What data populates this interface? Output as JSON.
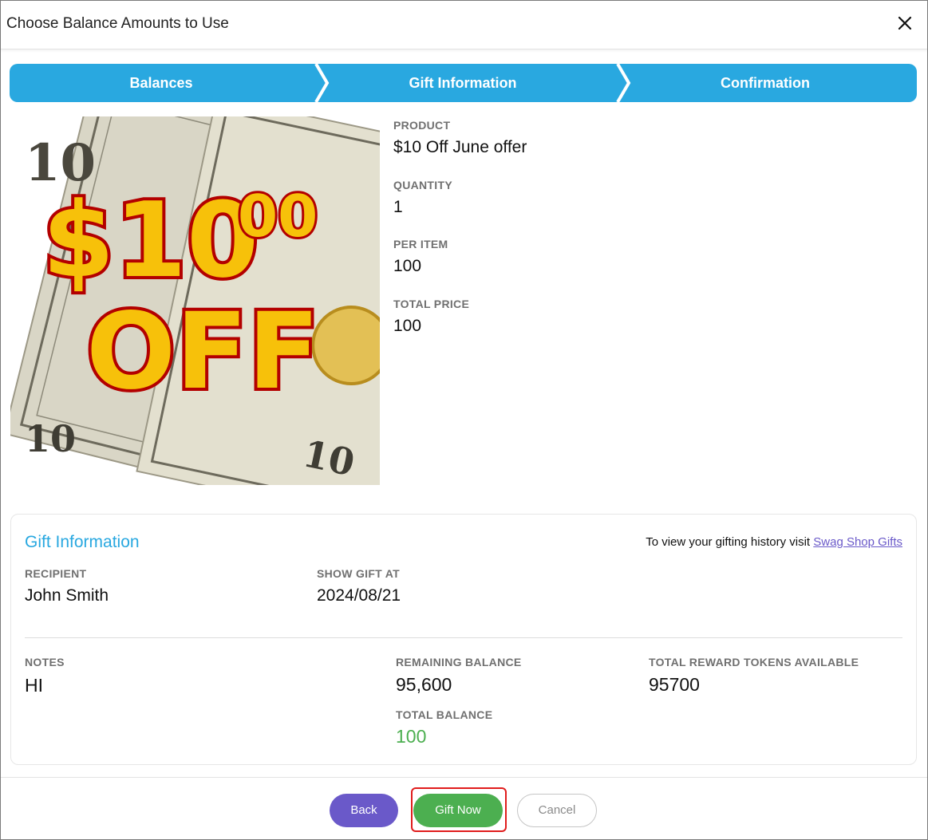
{
  "dialog": {
    "title": "Choose Balance Amounts to Use"
  },
  "stepper": {
    "steps": [
      {
        "label": "Balances"
      },
      {
        "label": "Gift Information"
      },
      {
        "label": "Confirmation"
      }
    ],
    "color": "#29a8e0"
  },
  "product_image": {
    "text_main": "$10",
    "text_cents": "00",
    "text_off": "OFF",
    "bill_number": "10"
  },
  "product": {
    "product_label": "PRODUCT",
    "product_value": "$10 Off June offer",
    "quantity_label": "QUANTITY",
    "quantity_value": "1",
    "per_item_label": "PER ITEM",
    "per_item_value": "100",
    "total_price_label": "TOTAL PRICE",
    "total_price_value": "100"
  },
  "gift_info": {
    "title": "Gift Information",
    "history_text": "To view your gifting history visit ",
    "history_link": "Swag Shop Gifts",
    "recipient_label": "RECIPIENT",
    "recipient_value": "John Smith",
    "show_gift_label": "SHOW GIFT AT",
    "show_gift_value": "2024/08/21",
    "notes_label": "NOTES",
    "notes_value": "HI",
    "remaining_label": "REMAINING BALANCE",
    "remaining_value": "95,600",
    "total_balance_label": "TOTAL BALANCE",
    "total_balance_value": "100",
    "tokens_label": "TOTAL REWARD TOKENS AVAILABLE",
    "tokens_value": "95700"
  },
  "footer": {
    "back_label": "Back",
    "gift_label": "Gift Now",
    "cancel_label": "Cancel"
  },
  "colors": {
    "accent": "#29a8e0",
    "back_button": "#6a59c9",
    "gift_button": "#4caf50",
    "total_balance": "#4caf50",
    "highlight": "#e01c1c"
  }
}
